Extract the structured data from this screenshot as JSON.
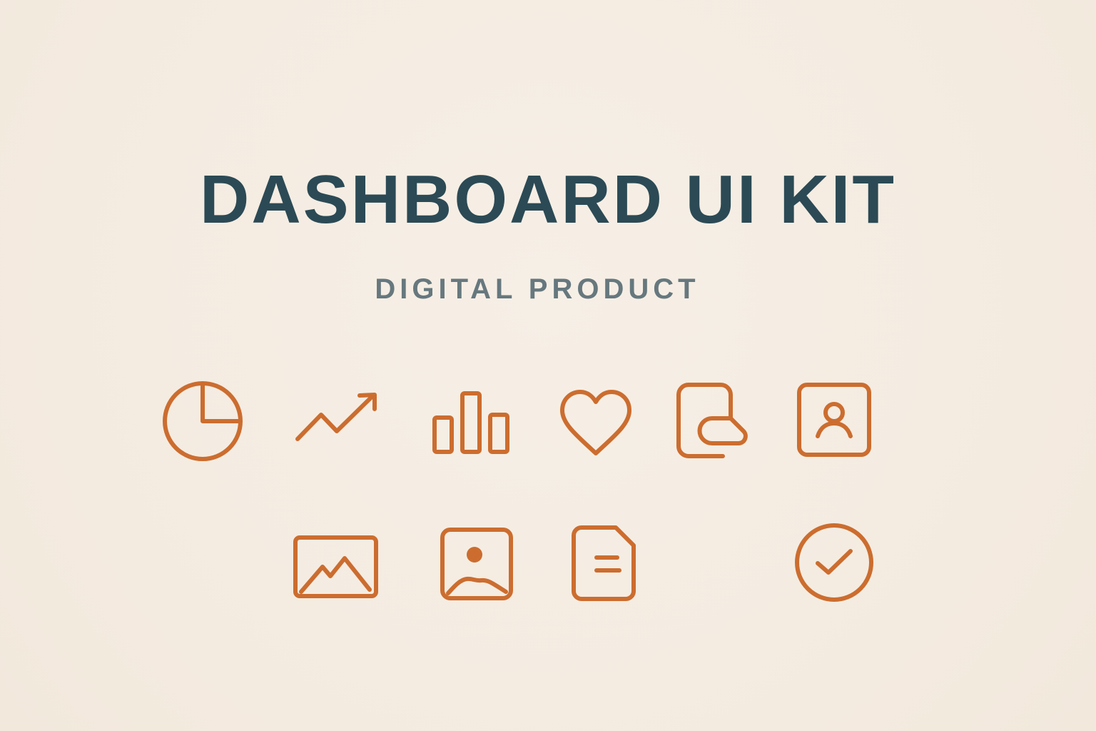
{
  "header": {
    "title": "DASHBOARD UI KIT",
    "subtitle": "DIGITAL PRODUCT"
  },
  "colors": {
    "background": "#f5ede3",
    "title": "#2b4a55",
    "subtitle": "#66787e",
    "icon_stroke": "#cc6d2f"
  },
  "icons": [
    "pie-chart-icon",
    "trend-up-icon",
    "bar-chart-icon",
    "heart-icon",
    "document-chat-icon",
    "user-profile-icon",
    "landscape-image-icon",
    "photo-icon",
    "document-icon",
    "check-circle-icon"
  ]
}
